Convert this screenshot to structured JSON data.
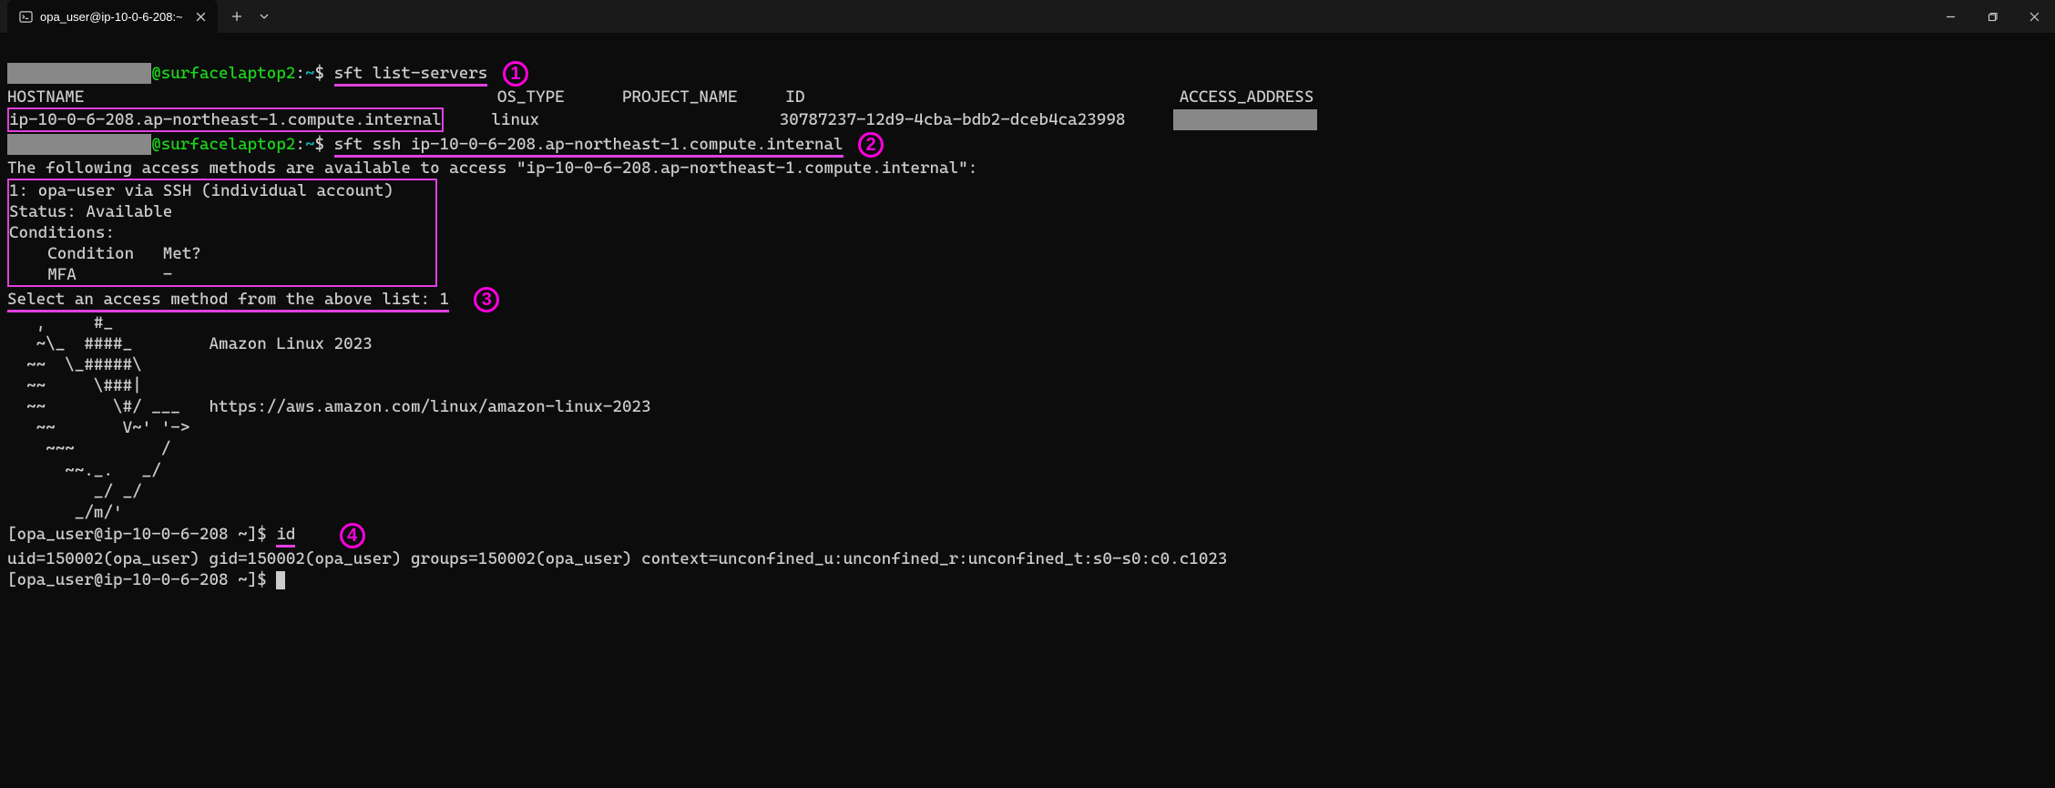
{
  "titlebar": {
    "tab_title": "opa_user@ip-10-0-6-208:~"
  },
  "prompt": {
    "host": "@surfacelaptop2",
    "sep": ":",
    "path": "~",
    "symbol": "$"
  },
  "cmd1": "sft list-servers",
  "table": {
    "header": {
      "hostname": "HOSTNAME",
      "os_type": "OS_TYPE",
      "project_name": "PROJECT_NAME",
      "id": "ID",
      "access_address": "ACCESS_ADDRESS"
    },
    "row": {
      "hostname": "ip-10-0-6-208.ap-northeast-1.compute.internal",
      "os_type": "linux",
      "project_name": "",
      "id": "30787237-12d9-4cba-bdb2-dceb4ca23998",
      "access_address": ""
    }
  },
  "cmd2": "sft ssh ip-10-0-6-208.ap-northeast-1.compute.internal",
  "ssh_intro": "The following access methods are available to access \"ip-10-0-6-208.ap-northeast-1.compute.internal\":",
  "method": {
    "l1": "1: opa-user via SSH (individual account)",
    "l2": "Status: Available",
    "l3": "Conditions:",
    "l4": "    Condition   Met?",
    "l5": "    MFA         -"
  },
  "select": {
    "prompt": "Select an access method from the above list: ",
    "value": "1"
  },
  "banner": {
    "l1": "   ,     #_",
    "l2": "   ~\\_  ####_        Amazon Linux 2023",
    "l3": "  ~~  \\_#####\\",
    "l4": "  ~~     \\###|",
    "l5": "  ~~       \\#/ ___   https://aws.amazon.com/linux/amazon-linux-2023",
    "l6": "   ~~       V~' '->",
    "l7": "    ~~~         /",
    "l8": "      ~~._.   _/",
    "l9": "         _/ _/",
    "l10": "       _/m/'"
  },
  "remote_prompt": {
    "text": "[opa_user@ip-10-0-6-208 ~]$ "
  },
  "cmd3": "id",
  "id_output": "uid=150002(opa_user) gid=150002(opa_user) groups=150002(opa_user) context=unconfined_u:unconfined_r:unconfined_t:s0-s0:c0.c1023",
  "annotations": {
    "a1": "1",
    "a2": "2",
    "a3": "3",
    "a4": "4"
  }
}
